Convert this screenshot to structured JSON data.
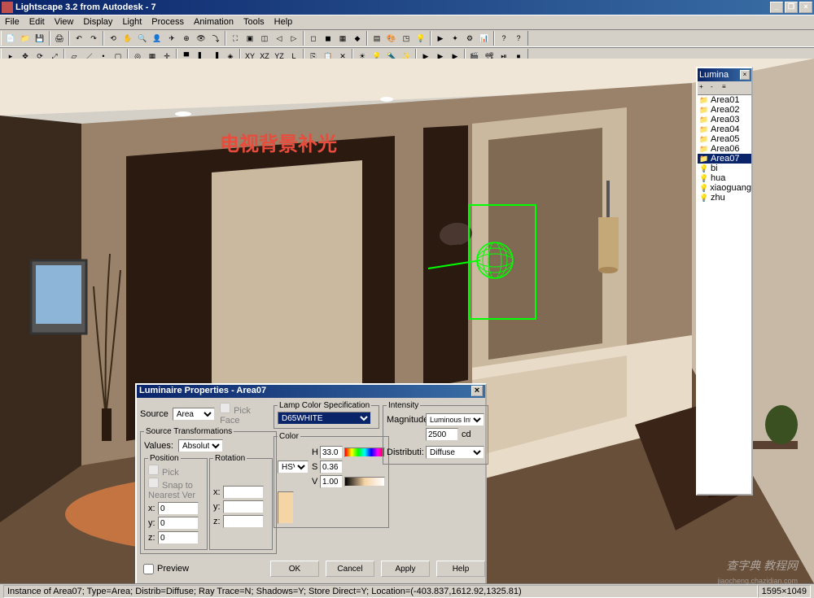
{
  "window": {
    "title": "Lightscape 3.2 from Autodesk - 7",
    "min": "_",
    "restore": "❐",
    "close": "×"
  },
  "menus": [
    "File",
    "Edit",
    "View",
    "Display",
    "Light",
    "Process",
    "Animation",
    "Tools",
    "Help"
  ],
  "annotation": "电视背景补光",
  "luminaire_panel": {
    "title": "Lumina",
    "items": [
      "Area01",
      "Area02",
      "Area03",
      "Area04",
      "Area05",
      "Area06",
      "Area07",
      "bi",
      "hua",
      "xiaoguang",
      "zhu"
    ],
    "selected_index": 6
  },
  "dialog": {
    "title": "Luminaire Properties - Area07",
    "close": "×",
    "source": {
      "legend": "",
      "label": "Source",
      "value": "Area",
      "pick_face": "Pick Face"
    },
    "transforms": {
      "legend": "Source Transformations",
      "values_label": "Values:",
      "values_value": "Absolute",
      "position": {
        "legend": "Position",
        "pick": "Pick",
        "snap": "Snap to Nearest Ver",
        "x": "x:",
        "y": "y:",
        "z": "z:",
        "xv": "0",
        "yv": "0",
        "zv": "0"
      },
      "rotation": {
        "legend": "Rotation",
        "x": "x:",
        "y": "y:",
        "z": "z:",
        "xv": "",
        "yv": "",
        "zv": ""
      }
    },
    "lamp": {
      "legend": "Lamp Color Specification",
      "spec_value": "D65WHITE",
      "color_legend": "Color",
      "colorspace": "HSV",
      "h_label": "H",
      "s_label": "S",
      "v_label": "V",
      "h": "33.0",
      "s": "0.36",
      "v": "1.00"
    },
    "intensity": {
      "legend": "Intensity",
      "magnitude_label": "Magnitude:",
      "magnitude_type": "Luminous Intensity",
      "magnitude_value": "2500",
      "magnitude_unit": "cd",
      "distribution_label": "Distributi:",
      "distribution_value": "Diffuse"
    },
    "preview": "Preview",
    "buttons": {
      "ok": "OK",
      "cancel": "Cancel",
      "apply": "Apply",
      "help": "Help"
    }
  },
  "statusbar": {
    "text": "Instance of Area07; Type=Area; Distrib=Diffuse; Ray Trace=N; Shadows=Y; Store Direct=Y; Location=(-403.837,1612.92,1325.81)",
    "coords": "1595×1049"
  },
  "watermark": {
    "line1": "查字典 教程网",
    "line2": "jiaocheng.chazidian.com"
  }
}
